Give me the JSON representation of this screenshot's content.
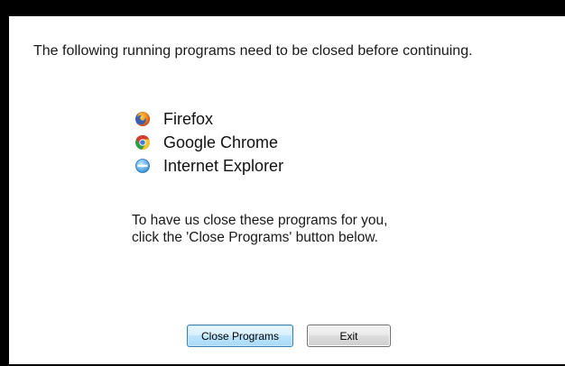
{
  "dialog": {
    "message": "The following running programs need to be closed before continuing.",
    "programs": [
      {
        "label": "Firefox",
        "icon": "firefox-icon"
      },
      {
        "label": "Google Chrome",
        "icon": "chrome-icon"
      },
      {
        "label": "Internet Explorer",
        "icon": "internet-explorer-icon"
      }
    ],
    "instructions": {
      "line1": "To have us close these programs for you,",
      "line2": "click the 'Close Programs' button below."
    },
    "buttons": {
      "close_label": "Close Programs",
      "exit_label": "Exit"
    }
  },
  "colors": {
    "backdrop": "#000000",
    "dialog_background": "#ffffff",
    "focused_button_border": "#3c7fb1"
  }
}
